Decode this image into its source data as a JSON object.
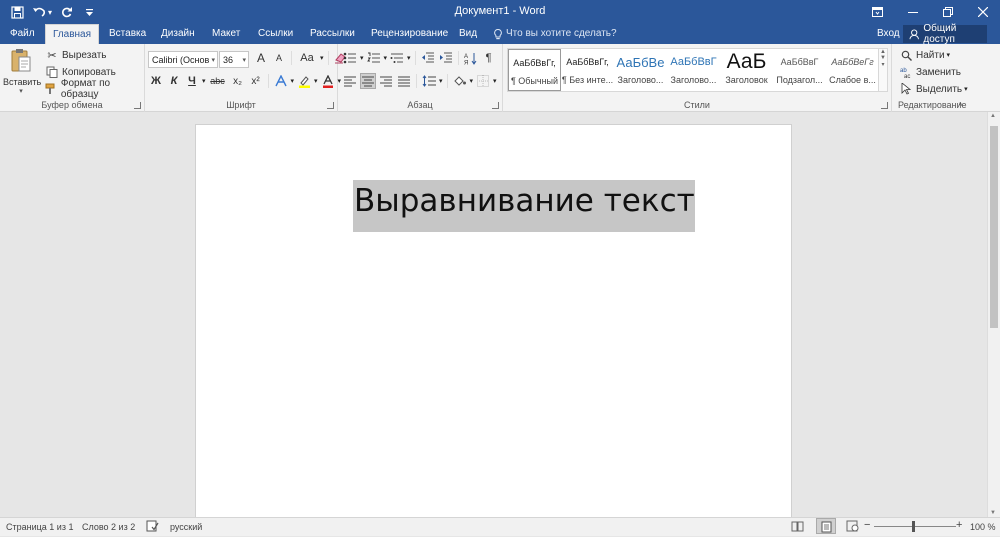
{
  "window": {
    "title": "Документ1 - Word",
    "accent": "#2b579a"
  },
  "tabs": [
    "Файл",
    "Главная",
    "Вставка",
    "Дизайн",
    "Макет",
    "Ссылки",
    "Рассылки",
    "Рецензирование",
    "Вид"
  ],
  "tell_me": "Что вы хотите сделать?",
  "account": {
    "sign_in": "Вход",
    "share": "Общий доступ"
  },
  "clipboard": {
    "paste": "Вставить",
    "cut": "Вырезать",
    "copy": "Копировать",
    "format_painter": "Формат по образцу",
    "label": "Буфер обмена"
  },
  "font": {
    "name": "Calibri (Основ",
    "size": "36",
    "bold": "Ж",
    "italic": "К",
    "underline": "Ч",
    "strike": "abc",
    "subscript": "x₂",
    "superscript": "x²",
    "grow": "A",
    "shrink": "A",
    "case": "Aa",
    "label": "Шрифт"
  },
  "paragraph": {
    "label": "Абзац",
    "pilcrow": "¶"
  },
  "styles": {
    "items": [
      {
        "sample": "АаБбВвГг,",
        "name": "¶ Обычный"
      },
      {
        "sample": "АаБбВвГг,",
        "name": "¶ Без инте..."
      },
      {
        "sample": "АаБбВе",
        "name": "Заголово..."
      },
      {
        "sample": "АаБбВвГ",
        "name": "Заголово..."
      },
      {
        "sample": "АаБ",
        "name": "Заголовок"
      },
      {
        "sample": "АаБбВвГ",
        "name": "Подзагол..."
      },
      {
        "sample": "АаБбВеГг",
        "name": "Слабое в..."
      }
    ],
    "label": "Стили"
  },
  "editing": {
    "find": "Найти",
    "replace": "Заменить",
    "select": "Выделить",
    "label": "Редактирование"
  },
  "document": {
    "text": "Выравнивание текста"
  },
  "status": {
    "page": "Страница 1 из 1",
    "words": "Слово 2 из 2",
    "language": "русский",
    "zoom": "100 %",
    "zoom_minus": "−",
    "zoom_plus": "+"
  }
}
